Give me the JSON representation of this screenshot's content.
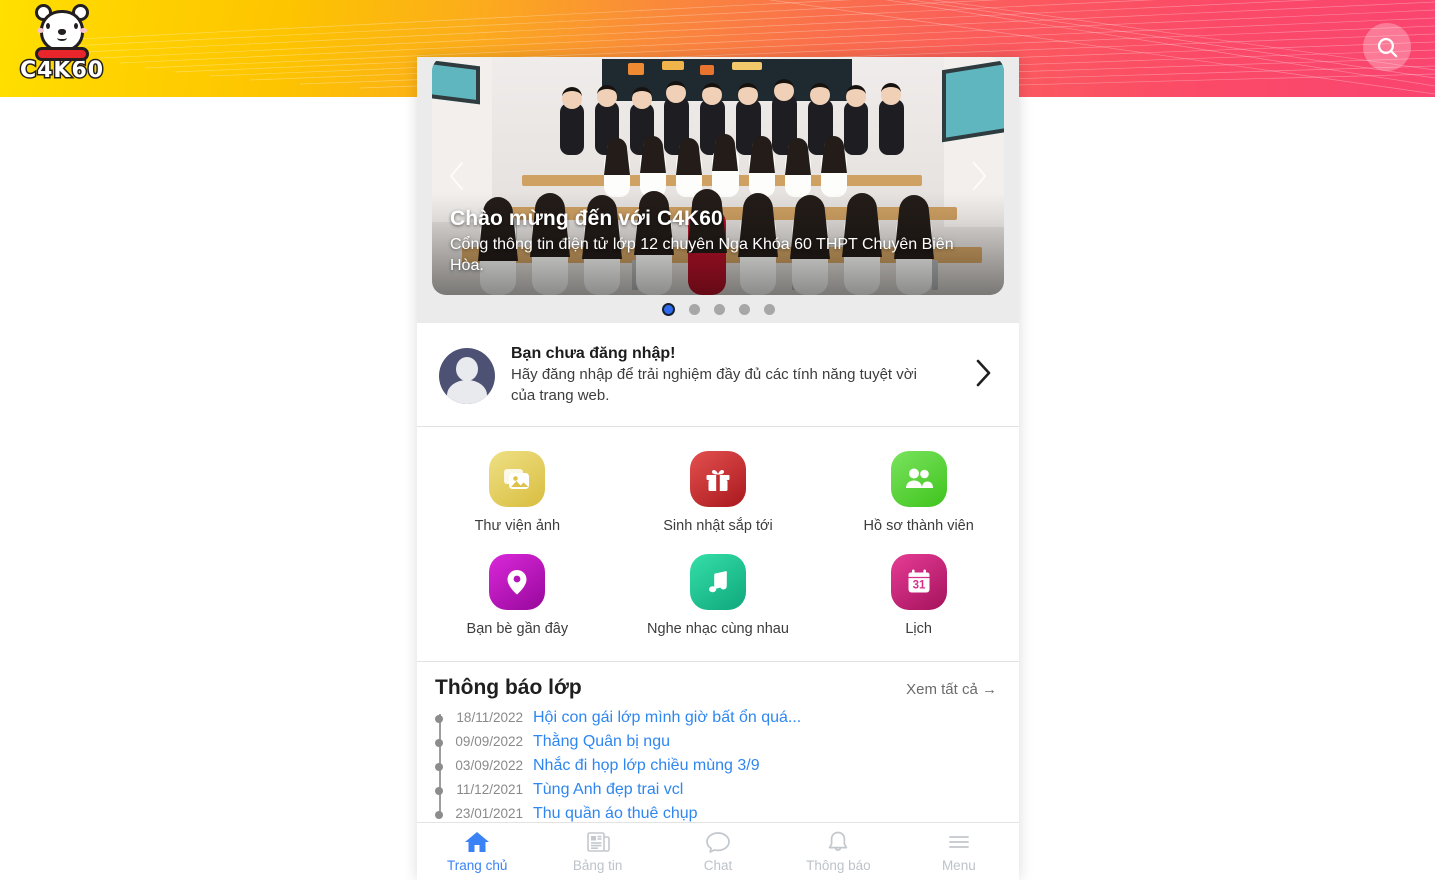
{
  "header": {
    "logo_text": "C4K60",
    "logo_icon": "polar-bear-logo",
    "search_icon": "search-icon",
    "gradient": [
      "#ffe000",
      "#fcae1a",
      "#fa6f4c",
      "#fa4570"
    ]
  },
  "carousel": {
    "title": "Chào mừng đến với C4K60",
    "subtitle": "Cổng thông tin điện tử lớp 12 chuyên Nga Khóa 60 THPT Chuyên Biên Hòa.",
    "prev_icon": "chevron-left-icon",
    "next_icon": "chevron-right-icon",
    "slide_count": 5,
    "active_slide": 1,
    "active_dot_color": "#2f6bf0",
    "image_alt": "class-photo"
  },
  "login_prompt": {
    "avatar_icon": "default-avatar",
    "title": "Bạn chưa đăng nhập!",
    "subtitle": "Hãy đăng nhập để trải nghiệm đầy đủ các tính năng tuyệt vời của trang web.",
    "chevron_icon": "chevron-right-icon"
  },
  "shortcuts": [
    {
      "label": "Thư viện ảnh",
      "icon": "photo-library-icon",
      "color_from": "#efe085",
      "color_to": "#dcc44a"
    },
    {
      "label": "Sinh nhật sắp tới",
      "icon": "gift-icon",
      "color_from": "#e4504f",
      "color_to": "#ad1b1f"
    },
    {
      "label": "Hồ sơ thành viên",
      "icon": "people-icon",
      "color_from": "#74e05a",
      "color_to": "#42c61f"
    },
    {
      "label": "Bạn bè gần đây",
      "icon": "location-pin-icon",
      "color_from": "#d61fd6",
      "color_to": "#9c0f9e"
    },
    {
      "label": "Nghe nhạc cùng nhau",
      "icon": "music-note-icon",
      "color_from": "#2fd9a5",
      "color_to": "#12a87e"
    },
    {
      "label": "Lịch",
      "icon": "calendar-icon",
      "color_from": "#e0328f",
      "color_to": "#a8165f"
    }
  ],
  "announcements": {
    "title": "Thông báo lớp",
    "see_all": "Xem tất cả",
    "see_all_icon": "arrow-right-icon",
    "items": [
      {
        "date": "18/11/2022",
        "title": "Hội con gái lớp mình giờ bất ổn quá..."
      },
      {
        "date": "09/09/2022",
        "title": "Thằng Quân bị ngu"
      },
      {
        "date": "03/09/2022",
        "title": "Nhắc đi họp lớp chiều mùng 3/9"
      },
      {
        "date": "11/12/2021",
        "title": "Tùng Anh đẹp trai vcl"
      },
      {
        "date": "23/01/2021",
        "title": "Thu quần áo thuê chụp"
      }
    ],
    "link_color": "#2e86f0"
  },
  "bottom_nav": {
    "active_color": "#3b82f6",
    "inactive_color": "#bdc3c9",
    "items": [
      {
        "label": "Trang chủ",
        "icon": "home-icon",
        "active": true
      },
      {
        "label": "Bảng tin",
        "icon": "newspaper-icon",
        "active": false
      },
      {
        "label": "Chat",
        "icon": "chat-bubble-icon",
        "active": false
      },
      {
        "label": "Thông báo",
        "icon": "bell-icon",
        "active": false
      },
      {
        "label": "Menu",
        "icon": "hamburger-menu-icon",
        "active": false
      }
    ]
  }
}
